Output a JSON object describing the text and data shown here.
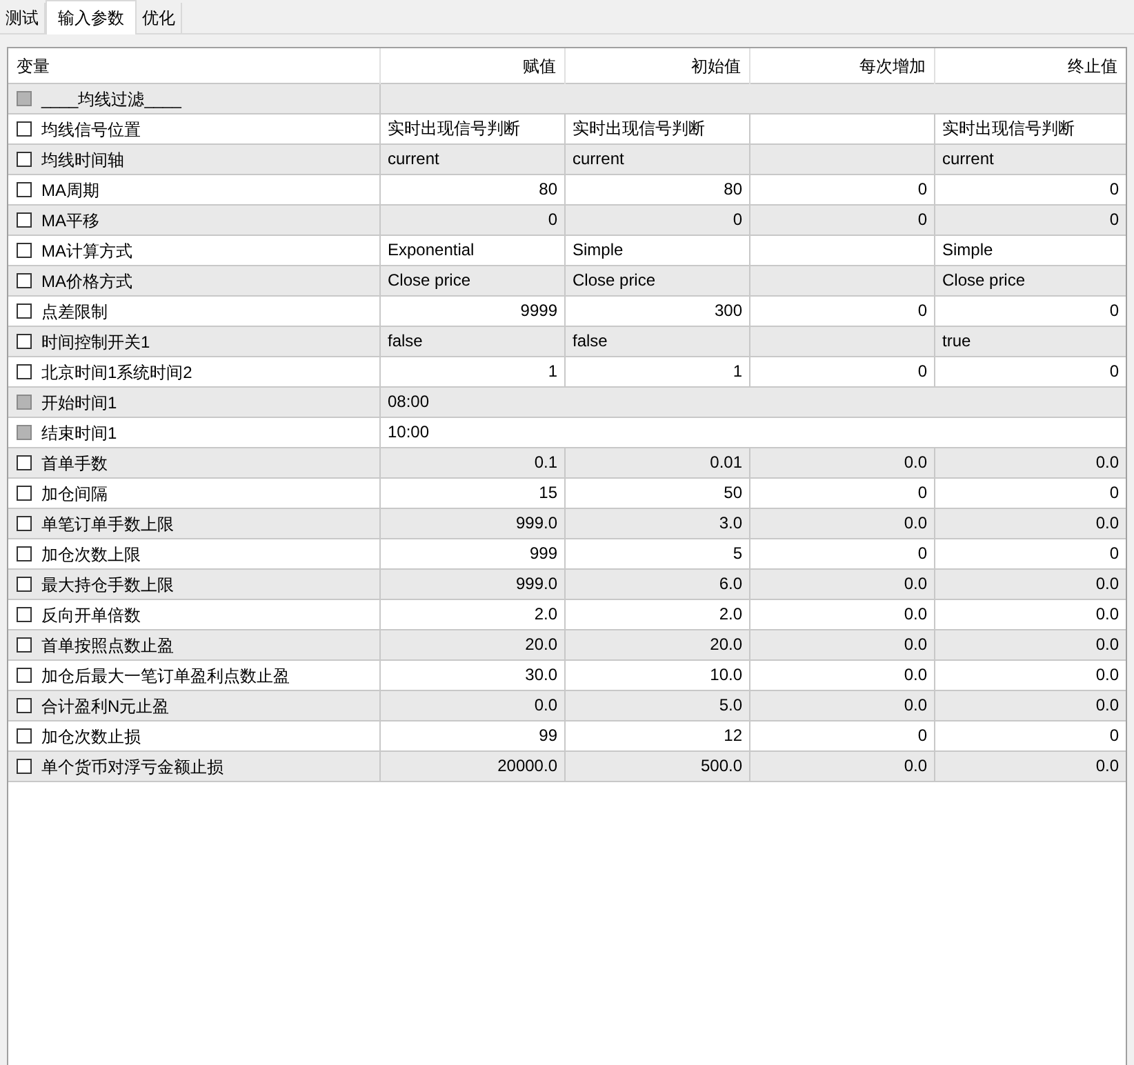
{
  "tabs": [
    {
      "label": "测试",
      "selected": false
    },
    {
      "label": "输入参数",
      "selected": true
    },
    {
      "label": "优化",
      "selected": false
    }
  ],
  "table": {
    "columns": [
      "变量",
      "赋值",
      "初始值",
      "每次增加",
      "终止值"
    ],
    "rows": [
      {
        "kind": "span",
        "checked": false,
        "disabled": true,
        "name": "____均线过滤____"
      },
      {
        "kind": "text",
        "checked": false,
        "disabled": false,
        "name": "均线信号位置",
        "value": "实时出现信号判断",
        "start": "实时出现信号判断",
        "stop": "实时出现信号判断"
      },
      {
        "kind": "text",
        "checked": false,
        "disabled": false,
        "name": "均线时间轴",
        "value": "current",
        "start": "current",
        "stop": "current"
      },
      {
        "kind": "number",
        "checked": false,
        "disabled": false,
        "name": "MA周期",
        "value": "80",
        "start": "80",
        "step": "0",
        "stop": "0"
      },
      {
        "kind": "number",
        "checked": false,
        "disabled": false,
        "name": "MA平移",
        "value": "0",
        "start": "0",
        "step": "0",
        "stop": "0"
      },
      {
        "kind": "text",
        "checked": false,
        "disabled": false,
        "name": "MA计算方式",
        "value": "Exponential",
        "start": "Simple",
        "stop": "Simple"
      },
      {
        "kind": "text",
        "checked": false,
        "disabled": false,
        "name": "MA价格方式",
        "value": "Close price",
        "start": "Close price",
        "stop": "Close price"
      },
      {
        "kind": "number",
        "checked": false,
        "disabled": false,
        "name": "点差限制",
        "value": "9999",
        "start": "300",
        "step": "0",
        "stop": "0"
      },
      {
        "kind": "text",
        "checked": false,
        "disabled": false,
        "name": "时间控制开关1",
        "value": "false",
        "start": "false",
        "stop": "true"
      },
      {
        "kind": "number",
        "checked": false,
        "disabled": false,
        "name": "北京时间1系统时间2",
        "value": "1",
        "start": "1",
        "step": "0",
        "stop": "0"
      },
      {
        "kind": "span",
        "checked": false,
        "disabled": true,
        "name": "开始时间1",
        "value": "08:00"
      },
      {
        "kind": "span",
        "checked": false,
        "disabled": true,
        "name": "结束时间1",
        "value": "10:00"
      },
      {
        "kind": "number",
        "checked": false,
        "disabled": false,
        "name": "首单手数",
        "value": "0.1",
        "start": "0.01",
        "step": "0.0",
        "stop": "0.0"
      },
      {
        "kind": "number",
        "checked": false,
        "disabled": false,
        "name": "加仓间隔",
        "value": "15",
        "start": "50",
        "step": "0",
        "stop": "0"
      },
      {
        "kind": "number",
        "checked": false,
        "disabled": false,
        "name": "单笔订单手数上限",
        "value": "999.0",
        "start": "3.0",
        "step": "0.0",
        "stop": "0.0"
      },
      {
        "kind": "number",
        "checked": false,
        "disabled": false,
        "name": "加仓次数上限",
        "value": "999",
        "start": "5",
        "step": "0",
        "stop": "0"
      },
      {
        "kind": "number",
        "checked": false,
        "disabled": false,
        "name": "最大持仓手数上限",
        "value": "999.0",
        "start": "6.0",
        "step": "0.0",
        "stop": "0.0"
      },
      {
        "kind": "number",
        "checked": false,
        "disabled": false,
        "name": "反向开单倍数",
        "value": "2.0",
        "start": "2.0",
        "step": "0.0",
        "stop": "0.0"
      },
      {
        "kind": "number",
        "checked": false,
        "disabled": false,
        "name": "首单按照点数止盈",
        "value": "20.0",
        "start": "20.0",
        "step": "0.0",
        "stop": "0.0"
      },
      {
        "kind": "number",
        "checked": false,
        "disabled": false,
        "name": "加仓后最大一笔订单盈利点数止盈",
        "value": "30.0",
        "start": "10.0",
        "step": "0.0",
        "stop": "0.0"
      },
      {
        "kind": "number",
        "checked": false,
        "disabled": false,
        "name": "合计盈利N元止盈",
        "value": "0.0",
        "start": "5.0",
        "step": "0.0",
        "stop": "0.0"
      },
      {
        "kind": "number",
        "checked": false,
        "disabled": false,
        "name": "加仓次数止损",
        "value": "99",
        "start": "12",
        "step": "0",
        "stop": "0"
      },
      {
        "kind": "number",
        "checked": false,
        "disabled": false,
        "name": "单个货币对浮亏金额止损",
        "value": "20000.0",
        "start": "500.0",
        "step": "0.0",
        "stop": "0.0"
      }
    ]
  }
}
